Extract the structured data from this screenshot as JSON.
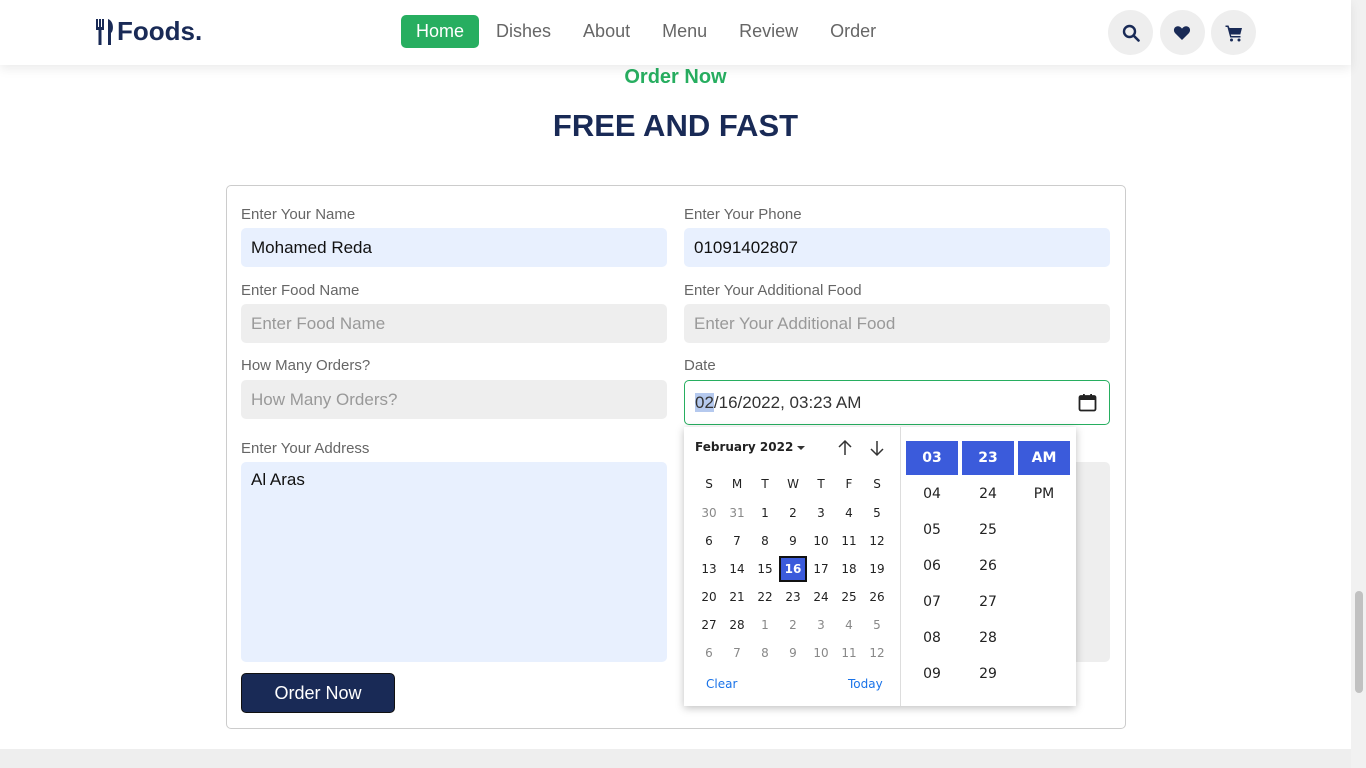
{
  "header": {
    "logo_text": "Foods.",
    "nav": [
      "Home",
      "Dishes",
      "About",
      "Menu",
      "Review",
      "Order"
    ],
    "active_nav": "Home",
    "icons": [
      "search-icon",
      "heart-icon",
      "cart-icon"
    ]
  },
  "section": {
    "sub_heading": "Order Now",
    "heading": "FREE AND FAST"
  },
  "form": {
    "name_label": "Enter Your Name",
    "name_value": "Mohamed Reda",
    "phone_label": "Enter Your Phone",
    "phone_value": "01091402807",
    "food_label": "Enter Food Name",
    "food_placeholder": "Enter Food Name",
    "additional_label": "Enter Your Additional Food",
    "additional_placeholder": "Enter Your Additional Food",
    "orders_label": "How Many Orders?",
    "orders_placeholder": "How Many Orders?",
    "date_label": "Date",
    "date_month": "02",
    "date_rest": "/16/2022, 03:23  AM",
    "address_label": "Enter Your Address",
    "address_value": "Al Aras",
    "submit_label": "Order Now"
  },
  "datepicker": {
    "month_label": "February 2022",
    "weekdays": [
      "S",
      "M",
      "T",
      "W",
      "T",
      "F",
      "S"
    ],
    "weeks": [
      [
        "30",
        "31",
        "1",
        "2",
        "3",
        "4",
        "5"
      ],
      [
        "6",
        "7",
        "8",
        "9",
        "10",
        "11",
        "12"
      ],
      [
        "13",
        "14",
        "15",
        "16",
        "17",
        "18",
        "19"
      ],
      [
        "20",
        "21",
        "22",
        "23",
        "24",
        "25",
        "26"
      ],
      [
        "27",
        "28",
        "1",
        "2",
        "3",
        "4",
        "5"
      ],
      [
        "6",
        "7",
        "8",
        "9",
        "10",
        "11",
        "12"
      ]
    ],
    "selected_day": "16",
    "clear_label": "Clear",
    "today_label": "Today",
    "hours": [
      "03",
      "04",
      "05",
      "06",
      "07",
      "08",
      "09"
    ],
    "minutes": [
      "23",
      "24",
      "25",
      "26",
      "27",
      "28",
      "29"
    ],
    "periods": [
      "AM",
      "PM"
    ],
    "selected_hour": "03",
    "selected_minute": "23",
    "selected_period": "AM"
  },
  "colors": {
    "accent": "#27ae60",
    "primary": "#192a56",
    "picker_selected": "#3b5bdb"
  }
}
